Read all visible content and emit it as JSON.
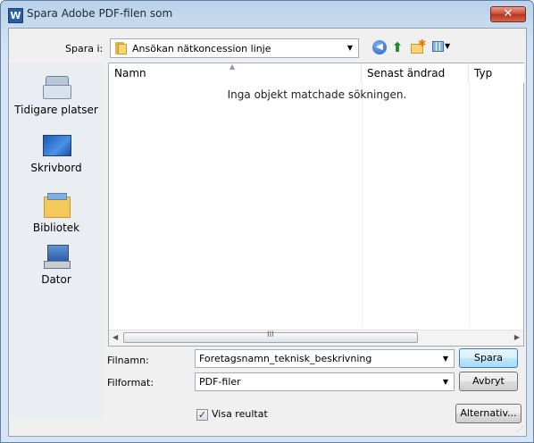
{
  "window": {
    "title": "Spara Adobe PDF-filen som",
    "app_icon": "W",
    "close_symbol": "✕"
  },
  "toolbar": {
    "save_in_label": "Spara i:",
    "save_in_value": "Ansökan nätkoncession linje",
    "icons": [
      "back-icon",
      "up-folder-icon",
      "new-folder-icon",
      "view-menu-icon"
    ]
  },
  "places": [
    {
      "label": "Tidigare platser",
      "icon": "recent-places-icon"
    },
    {
      "label": "Skrivbord",
      "icon": "desktop-icon"
    },
    {
      "label": "Bibliotek",
      "icon": "libraries-icon"
    },
    {
      "label": "Dator",
      "icon": "computer-icon"
    }
  ],
  "filelist": {
    "columns": [
      "Namn",
      "Senast ändrad",
      "Typ"
    ],
    "empty_message": "Inga objekt matchade sökningen.",
    "scroll_grip": "III"
  },
  "form": {
    "filename_label": "Filnamn:",
    "filename_value": "Foretagsnamn_teknisk_beskrivning",
    "format_label": "Filformat:",
    "format_value": "PDF-filer",
    "show_result_label": "Visa reultat",
    "show_result_checked": true
  },
  "buttons": {
    "save": "Spara",
    "cancel": "Avbryt",
    "options": "Alternativ..."
  }
}
